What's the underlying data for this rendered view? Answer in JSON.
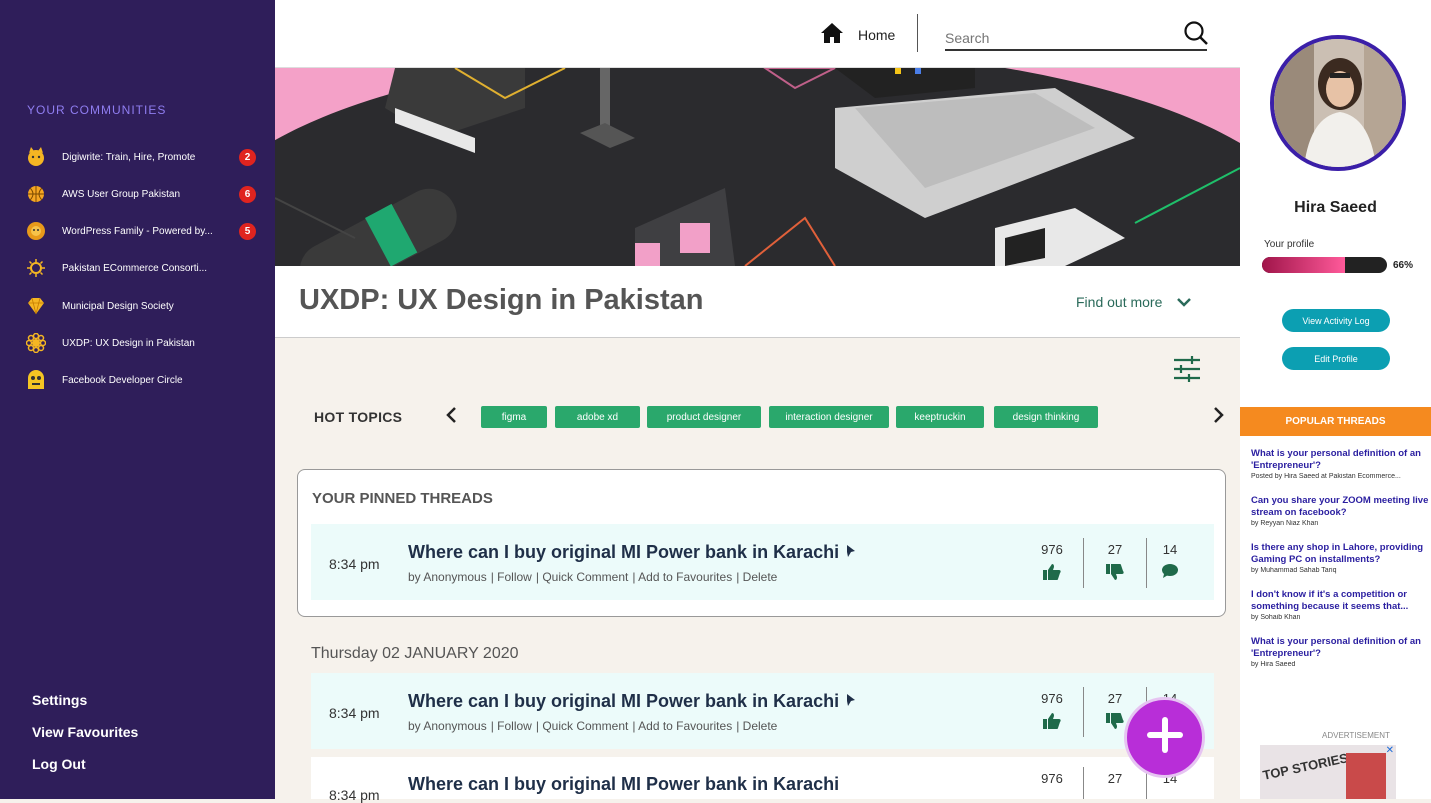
{
  "sidebar": {
    "heading": "YOUR COMMUNITIES",
    "communities": [
      {
        "label": "Digiwrite: Train, Hire, Promote",
        "badge": "2",
        "icon": "cat-icon"
      },
      {
        "label": "AWS User Group Pakistan",
        "badge": "6",
        "icon": "basketball-icon"
      },
      {
        "label": "WordPress Family - Powered by...",
        "badge": "5",
        "icon": "lion-icon"
      },
      {
        "label": "Pakistan ECommerce Consorti...",
        "badge": "",
        "icon": "sun-icon"
      },
      {
        "label": "Municipal Design Society",
        "badge": "",
        "icon": "diamond-icon"
      },
      {
        "label": "UXDP: UX Design in Pakistan",
        "badge": "",
        "icon": "flower-icon"
      },
      {
        "label": "Facebook Developer Circle",
        "badge": "",
        "icon": "monster-icon"
      }
    ],
    "settings": "Settings",
    "favourites": "View Favourites",
    "logout": "Log Out"
  },
  "header": {
    "home": "Home",
    "search_placeholder": "Search"
  },
  "community": {
    "title": "UXDP: UX Design in Pakistan",
    "find_out_more": "Find out more"
  },
  "hot_topics": {
    "label": "HOT TOPICS",
    "tags": [
      "figma",
      "adobe xd",
      "product designer",
      "interaction designer",
      "keeptruckin",
      "design thinking"
    ]
  },
  "pinned": {
    "heading": "YOUR PINNED THREADS",
    "thread": {
      "time": "8:34 pm",
      "title": "Where can I buy original MI Power bank in Karachi",
      "author": "by Anonymous",
      "actions": [
        "Follow",
        "Quick Comment",
        "Add to Favourites",
        "Delete"
      ],
      "likes": "976",
      "dislikes": "27",
      "comments": "14"
    }
  },
  "feed": {
    "date": "Thursday 02 JANUARY 2020",
    "threads": [
      {
        "time": "8:34 pm",
        "title": "Where can I buy original MI Power bank in Karachi",
        "author": "by Anonymous",
        "actions": [
          "Follow",
          "Quick Comment",
          "Add to Favourites",
          "Delete"
        ],
        "likes": "976",
        "dislikes": "27",
        "comments": "14"
      },
      {
        "time": "8:34 pm",
        "title": "Where can I buy original MI Power bank in Karachi",
        "likes": "976",
        "dislikes": "27",
        "comments": "14"
      }
    ]
  },
  "profile": {
    "name": "Hira Saeed",
    "your_profile": "Your profile",
    "completion": 0.66,
    "completion_label": "66%",
    "activity_btn": "View Activity Log",
    "edit_btn": "Edit Profile"
  },
  "popular": {
    "heading": "POPULAR THREADS",
    "items": [
      {
        "q": "What is your personal definition of an 'Entrepreneur'?",
        "by": "Posted by Hira Saeed at Pakistan Ecommerce..."
      },
      {
        "q": "Can you share your ZOOM meeting live stream on facebook?",
        "by": "by Reyyan Niaz Khan"
      },
      {
        "q": "Is there any shop in Lahore, providing Gaming PC on installments?",
        "by": "by Muhammad Sahab Tariq"
      },
      {
        "q": "I don't know if it's a competition or something because it seems that...",
        "by": "by Sohaib Khan"
      },
      {
        "q": "What is your personal definition of an 'Entrepreneur'?",
        "by": "by Hira Saeed"
      }
    ],
    "advertisement": "ADVERTISEMENT",
    "ad_text": "TOP STORIES"
  },
  "colors": {
    "sidebar": "#2f1e5a",
    "accent_green": "#2aa86c",
    "fab": "#b82ed8",
    "popular_header": "#f58a1f",
    "button_teal": "#0c9fb2"
  }
}
